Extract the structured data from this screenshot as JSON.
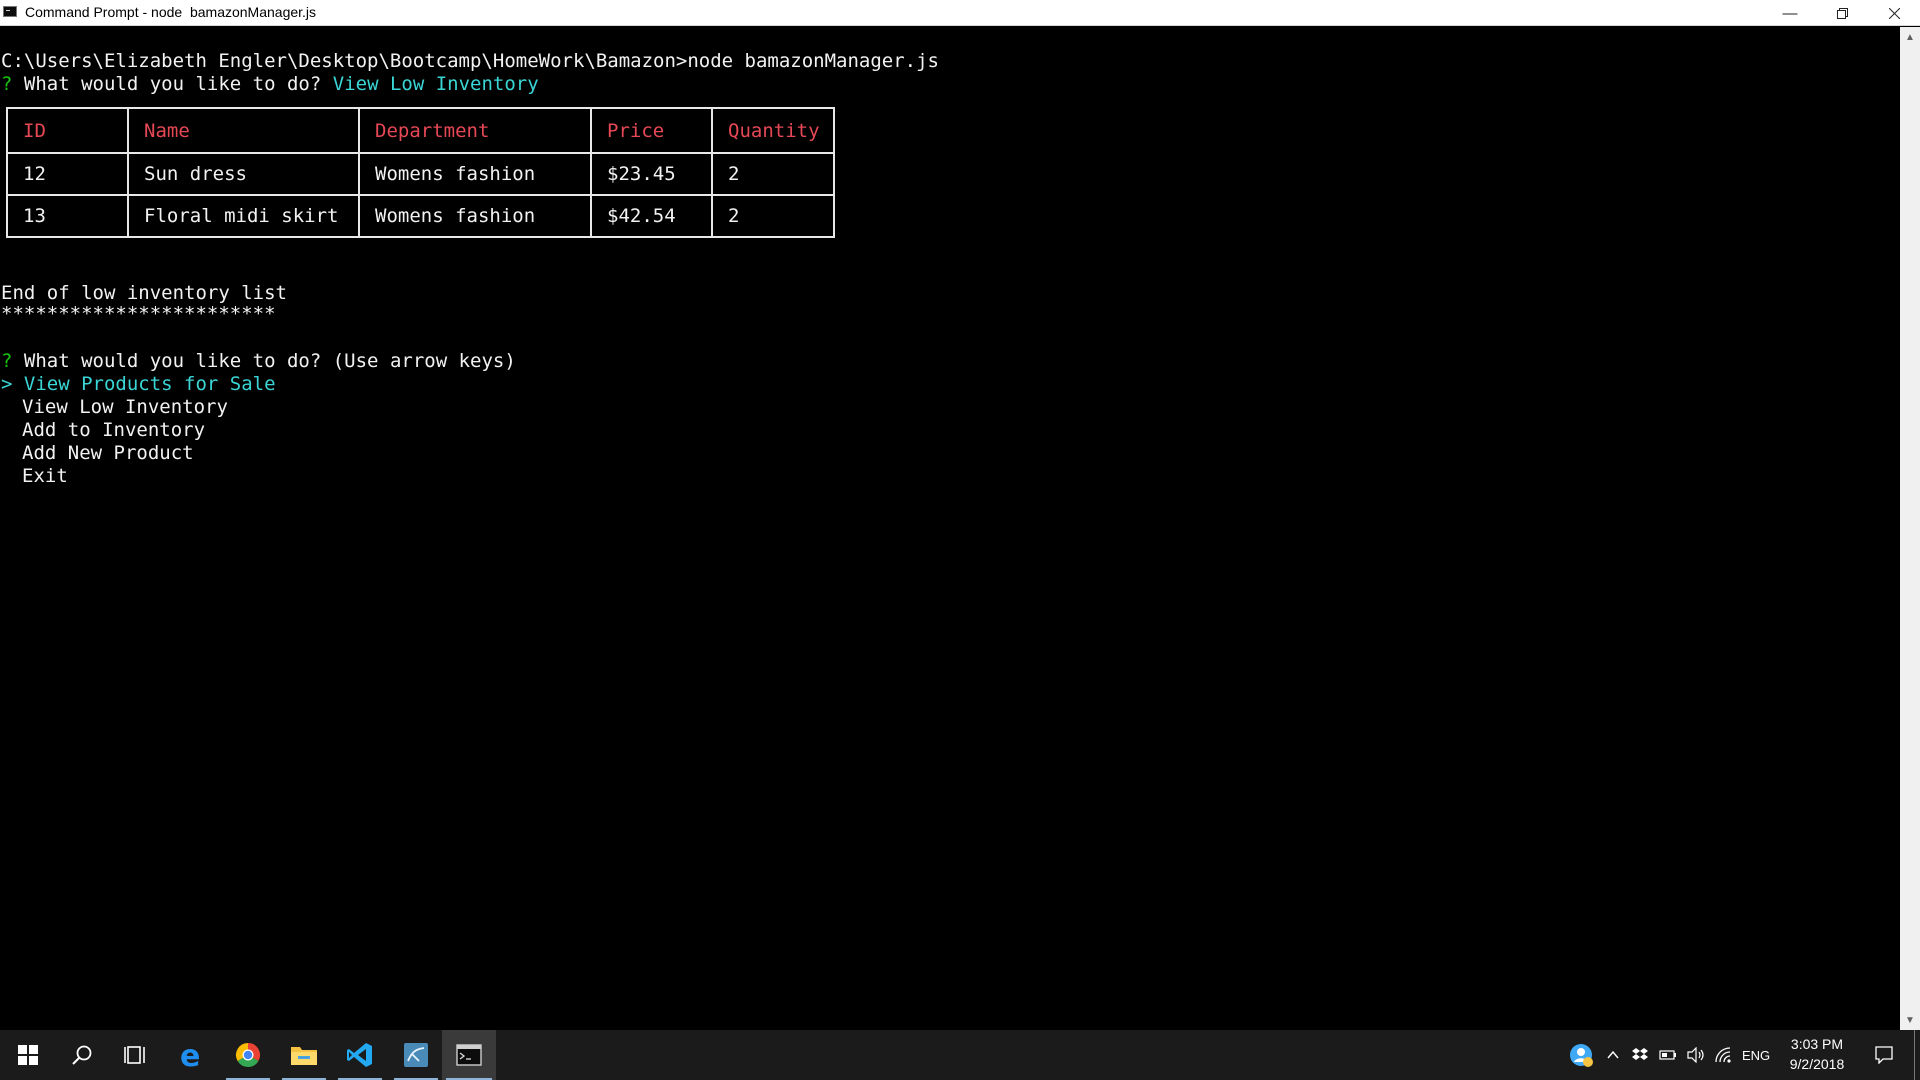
{
  "window": {
    "title": "Command Prompt - node  bamazonManager.js"
  },
  "console": {
    "cmd_line": "C:\\Users\\Elizabeth Engler\\Desktop\\Bootcamp\\HomeWork\\Bamazon>node bamazonManager.js",
    "prompt1_mark": "?",
    "prompt1_question": " What would you like to do? ",
    "prompt1_answer": "View Low Inventory",
    "table": {
      "headers": [
        "ID",
        "Name",
        "Department",
        "Price",
        "Quantity"
      ],
      "rows": [
        [
          "12",
          "Sun dress",
          "Womens fashion",
          "$23.45",
          "2"
        ],
        [
          "13",
          "Floral midi skirt",
          "Womens fashion",
          "$42.54",
          "2"
        ]
      ]
    },
    "end_text": "End of low inventory list",
    "stars": "************************",
    "prompt2_mark": "?",
    "prompt2_question": " What would you like to do? (Use arrow keys)",
    "menu": {
      "pointer": "> ",
      "selected": "View Products for Sale",
      "items": [
        "View Low Inventory",
        "Add to Inventory",
        "Add New Product",
        "Exit"
      ]
    }
  },
  "taskbar": {
    "apps": [
      "start-icon",
      "search-icon",
      "task-view-icon",
      "edge-icon",
      "chrome-icon",
      "file-explorer-icon",
      "vscode-icon",
      "mysql-workbench-icon",
      "command-prompt-icon"
    ],
    "tray": {
      "language": "ENG",
      "time": "3:03 PM",
      "date": "9/2/2018"
    }
  },
  "colors": {
    "prompt_green": "#16c60c",
    "answer_cyan": "#3ad6d6",
    "header_red": "#e74856"
  }
}
